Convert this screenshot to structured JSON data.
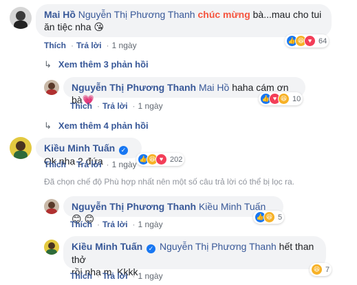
{
  "comment1": {
    "author": "Mai Hồ",
    "mention": "Nguyễn Thị Phương Thanh",
    "highlight": "chúc mừng",
    "text": " bà...mau cho tui ăn tiệc nha",
    "emoji": "😘",
    "like": "Thích",
    "reply": "Trả lời",
    "time": "1 ngày",
    "reactions": {
      "count": "64",
      "icons": [
        "like-icon",
        "haha-icon",
        "love-icon"
      ]
    }
  },
  "more1": {
    "label": "Xem thêm 3 phản hồi"
  },
  "reply1": {
    "author": "Nguyễn Thị Phương Thanh",
    "mention": "Mai Hồ",
    "text": "haha cám ơn bà",
    "emoji": "💗",
    "like": "Thích",
    "reply": "Trả lời",
    "time": "1 ngày",
    "reactions": {
      "count": "10",
      "icons": [
        "like-icon",
        "love-icon",
        "haha-icon"
      ]
    }
  },
  "more2": {
    "label": "Xem thêm 4 phản hồi"
  },
  "comment2": {
    "author": "Kiều Minh Tuấn",
    "text": "Ok nha 2 đứa",
    "like": "Thích",
    "reply": "Trả lời",
    "time": "1 ngày",
    "reactions": {
      "count": "202",
      "icons": [
        "like-icon",
        "haha-icon",
        "love-icon"
      ]
    }
  },
  "notice": "Đã chọn chế độ Phù hợp nhất nên một số câu trả lời có thể bị lọc ra.",
  "reply2": {
    "author": "Nguyễn Thị Phương Thanh",
    "mention": "Kiều Minh Tuấn",
    "emoji": "😊 😊",
    "like": "Thích",
    "reply": "Trả lời",
    "time": "1 ngày",
    "reactions": {
      "count": "5",
      "icons": [
        "like-icon",
        "haha-icon"
      ]
    }
  },
  "reply3": {
    "author": "Kiều Minh Tuấn",
    "mention": "Nguyễn Thị Phương Thanh",
    "text_line1": " hết than thở",
    "text_line2": "rồi nha m. Kkkk",
    "like": "Thích",
    "reply": "Trả lời",
    "time": "1 ngày",
    "reactions": {
      "count": "7",
      "icons": [
        "haha-icon"
      ]
    }
  },
  "colors": {
    "link": "#385898",
    "bubble": "#f2f3f5",
    "highlight": "#f5533d",
    "like": "#1877f2",
    "haha": "#f7b125",
    "love": "#f33e58"
  }
}
